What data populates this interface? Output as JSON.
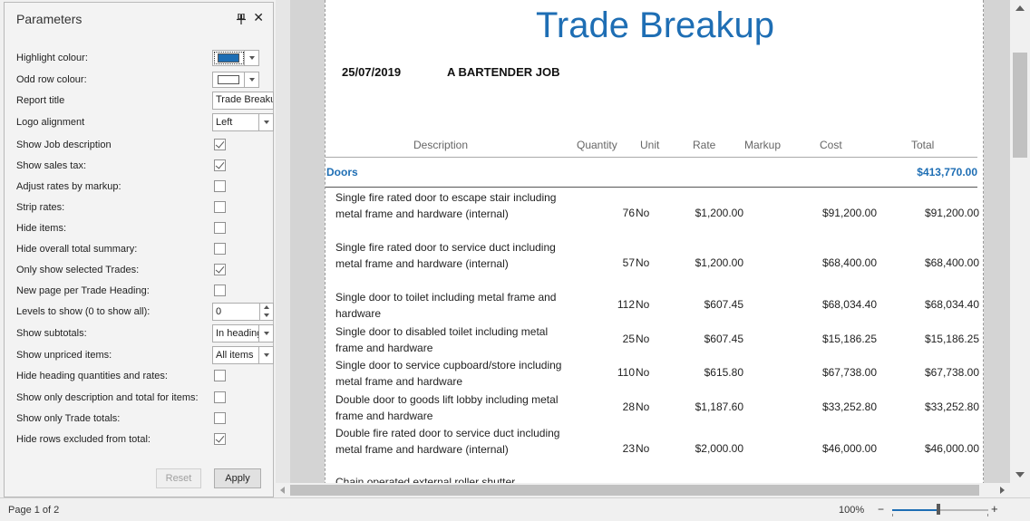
{
  "panel": {
    "title": "Parameters",
    "params": [
      {
        "label": "Highlight colour:",
        "type": "color",
        "value": "#1e6eb4"
      },
      {
        "label": "Odd row colour:",
        "type": "color",
        "value": "#ffffff"
      },
      {
        "label": "Report title",
        "type": "text",
        "value": "Trade Breakup"
      },
      {
        "label": "Logo alignment",
        "type": "select",
        "value": "Left"
      },
      {
        "label": "Show Job description",
        "type": "checkbox",
        "checked": true
      },
      {
        "label": "Show sales tax:",
        "type": "checkbox",
        "checked": true
      },
      {
        "label": "Adjust rates by markup:",
        "type": "checkbox",
        "checked": false
      },
      {
        "label": "Strip rates:",
        "type": "checkbox",
        "checked": false
      },
      {
        "label": "Hide items:",
        "type": "checkbox",
        "checked": false
      },
      {
        "label": "Hide overall total summary:",
        "type": "checkbox",
        "checked": false
      },
      {
        "label": "Only show selected Trades:",
        "type": "checkbox",
        "checked": true
      },
      {
        "label": "New page per Trade Heading:",
        "type": "checkbox",
        "checked": false
      },
      {
        "label": "Levels to show (0 to show all):",
        "type": "spin",
        "value": "0"
      },
      {
        "label": "Show subtotals:",
        "type": "select",
        "value": "In headings"
      },
      {
        "label": "Show unpriced items:",
        "type": "select",
        "value": "All items"
      },
      {
        "label": "Hide heading quantities and rates:",
        "type": "checkbox",
        "checked": false
      },
      {
        "label": "Show only description and total for items:",
        "type": "checkbox",
        "checked": false
      },
      {
        "label": "Show only Trade totals:",
        "type": "checkbox",
        "checked": false
      },
      {
        "label": "Hide rows excluded from total:",
        "type": "checkbox",
        "checked": true
      }
    ],
    "reset_label": "Reset",
    "apply_label": "Apply"
  },
  "report": {
    "title": "Trade Breakup",
    "date": "25/07/2019",
    "job": "A BARTENDER JOB",
    "columns": {
      "description": "Description",
      "quantity": "Quantity",
      "unit": "Unit",
      "rate": "Rate",
      "markup": "Markup",
      "cost": "Cost",
      "total": "Total"
    },
    "trade": {
      "name": "Doors",
      "total": "$413,770.00"
    },
    "items": [
      {
        "desc": "Single fire rated door to escape stair including metal frame and hardware (internal)",
        "qty": "76",
        "unit": "No",
        "rate": "$1,200.00",
        "cost": "$91,200.00",
        "total": "$91,200.00"
      },
      {
        "desc": "Single fire rated door to service duct including metal frame and hardware (internal)",
        "qty": "57",
        "unit": "No",
        "rate": "$1,200.00",
        "cost": "$68,400.00",
        "total": "$68,400.00"
      },
      {
        "desc": "Single door to toilet including metal frame and hardware",
        "qty": "112",
        "unit": "No",
        "rate": "$607.45",
        "cost": "$68,034.40",
        "total": "$68,034.40"
      },
      {
        "desc": "Single door to disabled toilet including metal frame and hardware",
        "qty": "25",
        "unit": "No",
        "rate": "$607.45",
        "cost": "$15,186.25",
        "total": "$15,186.25"
      },
      {
        "desc": "Single door to service cupboard/store including metal frame and hardware",
        "qty": "110",
        "unit": "No",
        "rate": "$615.80",
        "cost": "$67,738.00",
        "total": "$67,738.00"
      },
      {
        "desc": "Double door to goods lift lobby including metal frame and hardware",
        "qty": "28",
        "unit": "No",
        "rate": "$1,187.60",
        "cost": "$33,252.80",
        "total": "$33,252.80"
      },
      {
        "desc": "Double fire rated door to service duct including metal frame and hardware (internal)",
        "qty": "23",
        "unit": "No",
        "rate": "$2,000.00",
        "cost": "$46,000.00",
        "total": "$46,000.00"
      },
      {
        "desc": "Chain operated external roller shutter",
        "qty": "",
        "unit": "",
        "rate": "",
        "cost": "",
        "total": ""
      }
    ]
  },
  "status": {
    "page_info": "Page 1 of 2",
    "zoom": "100%",
    "zoom_minus": "−",
    "zoom_plus": "+"
  }
}
